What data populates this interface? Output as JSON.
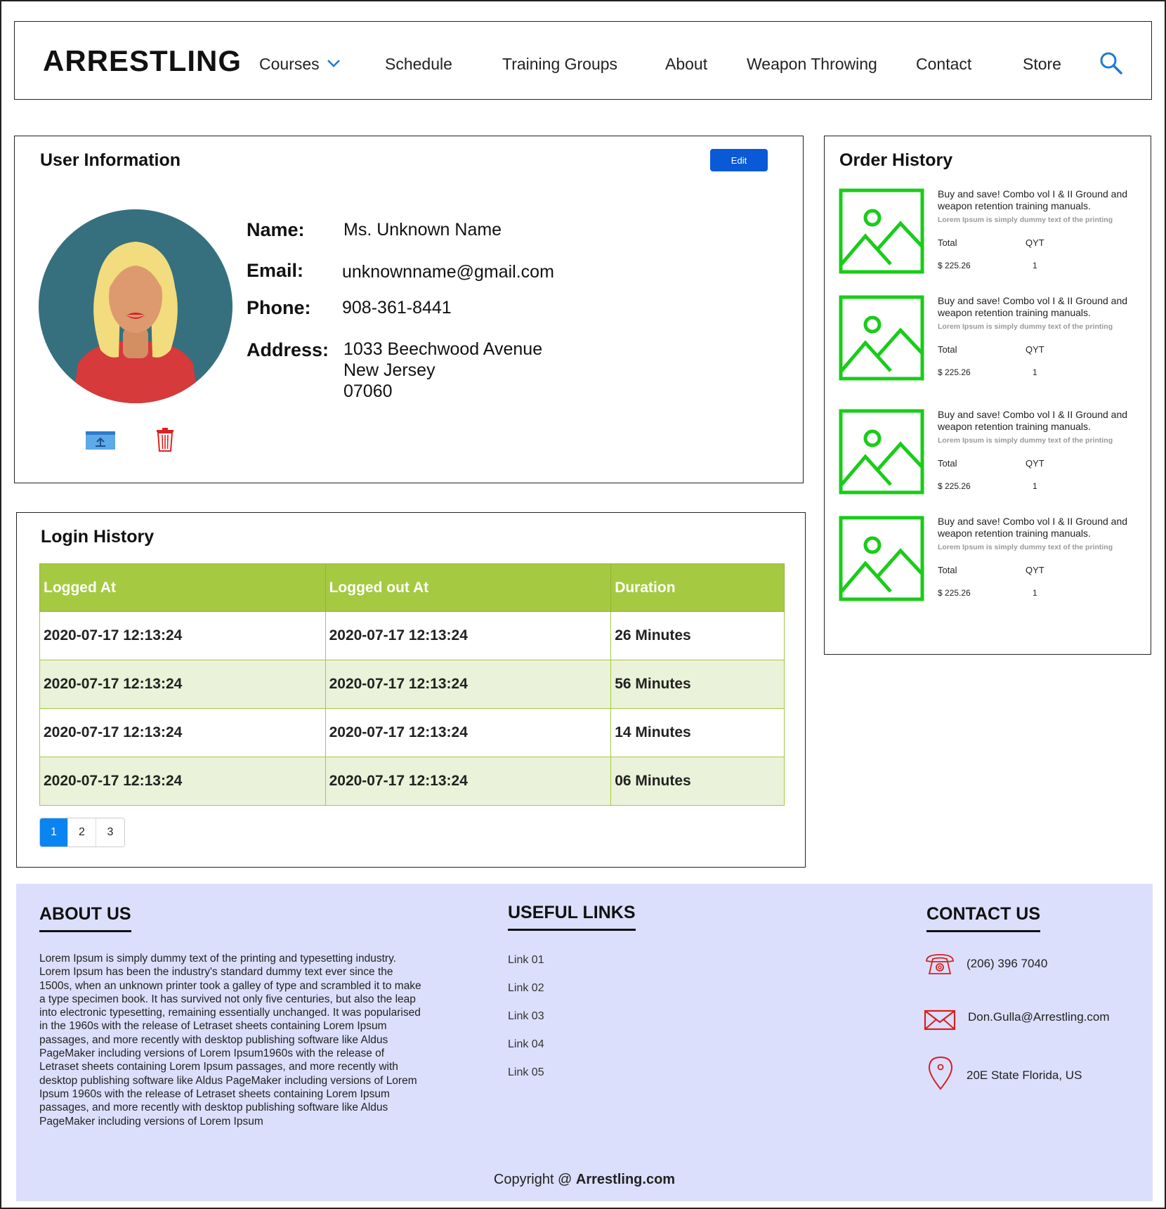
{
  "header": {
    "logo": "ARRESTLING",
    "nav": [
      "Courses",
      "Schedule",
      "Training Groups",
      "About",
      "Weapon Throwing",
      "Contact",
      "Store"
    ]
  },
  "user_info": {
    "title": "User Information",
    "edit_label": "Edit",
    "labels": {
      "name": "Name:",
      "email": "Email:",
      "phone": "Phone:",
      "address": "Address:"
    },
    "name": "Ms. Unknown Name",
    "email": "unknownname@gmail.com",
    "phone": "908-361-8441",
    "address_line1": "1033  Beechwood Avenue",
    "address_line2": "New Jersey",
    "address_line3": "07060"
  },
  "login_history": {
    "title": "Login History",
    "columns": [
      "Logged At",
      "Logged out At",
      "Duration"
    ],
    "rows": [
      [
        "2020-07-17 12:13:24",
        "2020-07-17 12:13:24",
        "26 Minutes"
      ],
      [
        "2020-07-17 12:13:24",
        "2020-07-17 12:13:24",
        "56 Minutes"
      ],
      [
        "2020-07-17 12:13:24",
        "2020-07-17 12:13:24",
        "14 Minutes"
      ],
      [
        "2020-07-17 12:13:24",
        "2020-07-17 12:13:24",
        "06 Minutes"
      ]
    ],
    "pages": [
      "1",
      "2",
      "3"
    ],
    "active_page": "1"
  },
  "order_history": {
    "title": "Order History",
    "items": [
      {
        "title": "Buy and save! Combo vol I & II Ground and weapon retention training manuals.",
        "subtitle": "Lorem Ipsum is simply dummy text of the printing",
        "total_label": "Total",
        "qty_label": "QYT",
        "total": "$ 225.26",
        "qty": "1"
      },
      {
        "title": "Buy and save! Combo vol I & II Ground and weapon retention training manuals.",
        "subtitle": "Lorem Ipsum is simply dummy text of the printing",
        "total_label": "Total",
        "qty_label": "QYT",
        "total": "$ 225.26",
        "qty": "1"
      },
      {
        "title": "Buy and save! Combo vol I & II Ground and weapon retention training manuals.",
        "subtitle": "Lorem Ipsum is simply dummy text of the printing",
        "total_label": "Total",
        "qty_label": "QYT",
        "total": "$ 225.26",
        "qty": "1"
      },
      {
        "title": "Buy and save! Combo vol I & II Ground and weapon retention training manuals.",
        "subtitle": "Lorem Ipsum is simply dummy text of the printing",
        "total_label": "Total",
        "qty_label": "QYT",
        "total": "$ 225.26",
        "qty": "1"
      }
    ]
  },
  "footer": {
    "about_title": "ABOUT US",
    "about_text": "Lorem Ipsum is simply dummy text of the printing and typesetting industry. Lorem Ipsum has been the industry's standard dummy text ever since the 1500s, when an unknown printer took a galley of type and scrambled it to make a type specimen book. It has survived not only five centuries, but also the leap into electronic typesetting, remaining essentially unchanged. It was popularised in the 1960s with the release of Letraset sheets containing Lorem Ipsum passages, and more recently with desktop publishing software like Aldus PageMaker including versions of Lorem Ipsum1960s with the release of Letraset sheets containing Lorem Ipsum passages, and more recently with desktop publishing software like Aldus PageMaker including versions of Lorem Ipsum 1960s with the release of Letraset sheets containing Lorem Ipsum passages, and more recently with desktop publishing software like Aldus PageMaker including versions of Lorem Ipsum",
    "links_title": "USEFUL LINKS",
    "links": [
      "Link 01",
      "Link 02",
      "Link 03",
      "Link 04",
      "Link 05"
    ],
    "contact_title": "CONTACT US",
    "phone": "(206) 396 7040",
    "email": "Don.Gulla@Arrestling.com",
    "location": "20E State Florida, US",
    "copyright_prefix": "Copyright @ ",
    "copyright_site": "Arrestling.com"
  },
  "colors": {
    "accent_blue": "#0a5ad7",
    "table_green": "#a6c942",
    "row_alt": "#eaf2d9",
    "placeholder_green": "#19cc19",
    "footer_bg": "#dcdffb",
    "icon_red": "#d42020"
  },
  "icons": [
    "chevron-down-icon",
    "search-icon",
    "upload-icon",
    "trash-icon",
    "image-placeholder-icon",
    "phone-icon",
    "mail-icon",
    "location-pin-icon"
  ]
}
